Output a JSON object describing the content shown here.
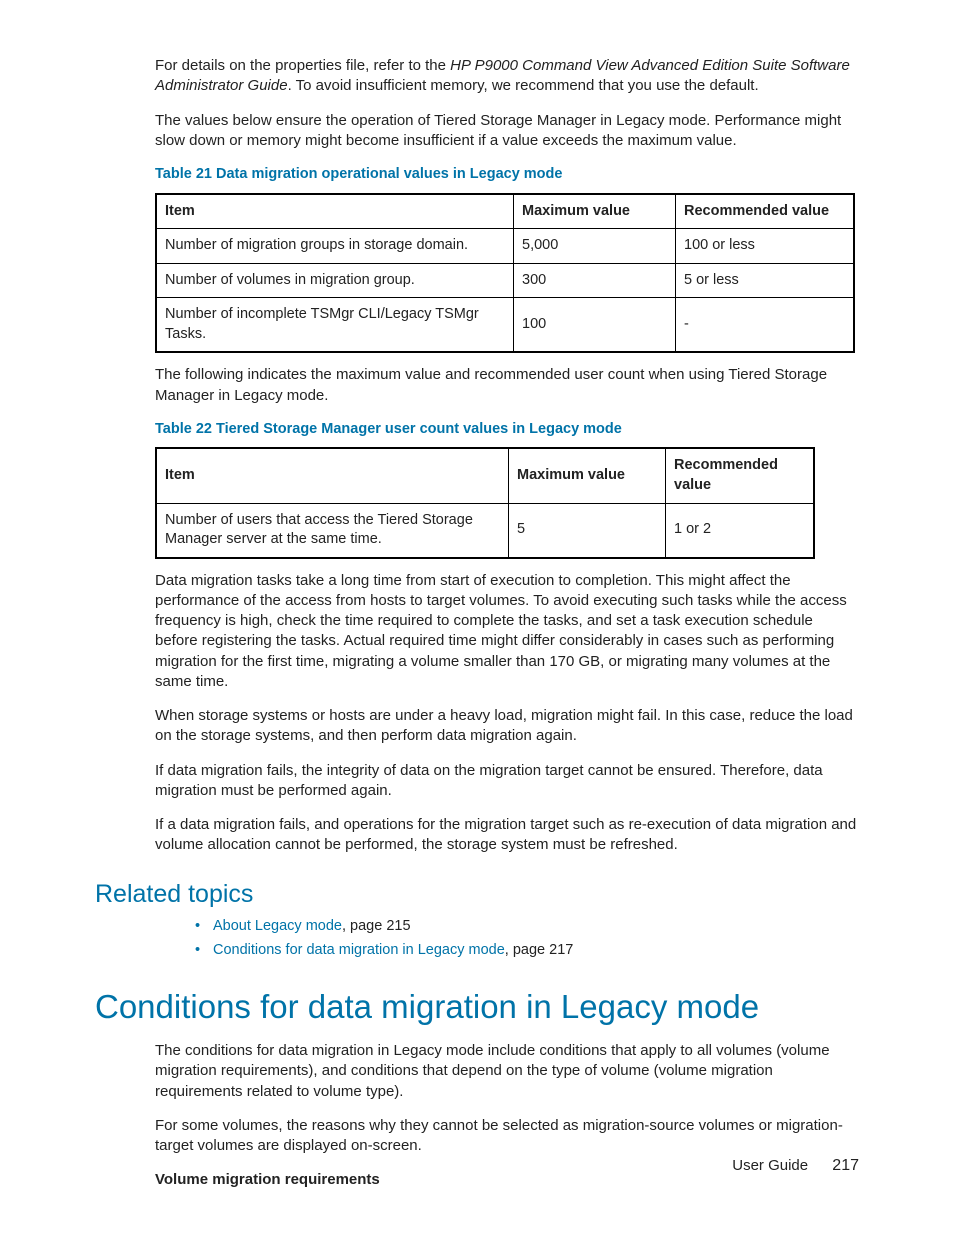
{
  "p1a": "For details on the properties file, refer to the ",
  "p1b": "HP P9000 Command View Advanced Edition Suite Software Administrator Guide",
  "p1c": ". To avoid insufficient memory, we recommend that you use the default.",
  "p2": "The values below ensure the operation of Tiered Storage Manager in Legacy mode. Performance might slow down or memory might become insufficient if a value exceeds the maximum value.",
  "t21_title": "Table 21 Data migration operational values in Legacy mode",
  "t21": {
    "h1": "Item",
    "h2": "Maximum value",
    "h3": "Recommended value",
    "r1c1": "Number of migration groups in storage domain.",
    "r1c2": "5,000",
    "r1c3": "100 or less",
    "r2c1": "Number of volumes in migration group.",
    "r2c2": "300",
    "r2c3": "5 or less",
    "r3c1": "Number of incomplete TSMgr CLI/Legacy TSMgr Tasks.",
    "r3c2": "100",
    "r3c3": "-"
  },
  "p3": "The following indicates the maximum value and recommended user count when using Tiered Storage Manager in Legacy mode.",
  "t22_title": "Table 22 Tiered Storage Manager user count values in Legacy mode",
  "t22": {
    "h1": "Item",
    "h2": "Maximum value",
    "h3": "Recommended value",
    "r1c1": "Number of users that access the Tiered Storage Manager server at the same time.",
    "r1c2": "5",
    "r1c3": "1 or 2"
  },
  "p4": "Data migration tasks take a long time from start of execution to completion. This might affect the performance of the access from hosts to target volumes. To avoid executing such tasks while the access frequency is high, check the time required to complete the tasks, and set a task execution schedule before registering the tasks. Actual required time might differ considerably in cases such as performing migration for the first time, migrating a volume smaller than 170 GB, or migrating many volumes at the same time.",
  "p5": "When storage systems or hosts are under a heavy load, migration might fail. In this case, reduce the load on the storage systems, and then perform data migration again.",
  "p6": "If data migration fails, the integrity of data on the migration target cannot be ensured. Therefore, data migration must be performed again.",
  "p7": "If a data migration fails, and operations for the migration target such as re-execution of data migration and volume allocation cannot be performed, the storage system must be refreshed.",
  "related_heading": "Related topics",
  "rel1_link": "About Legacy mode",
  "rel1_rest": ", page 215",
  "rel2_link": "Conditions for data migration in Legacy mode",
  "rel2_rest": ", page 217",
  "section_heading": "Conditions for data migration in Legacy mode",
  "p8": "The conditions for data migration in Legacy mode include conditions that apply to all volumes (volume migration requirements), and conditions that depend on the type of volume (volume migration requirements related to volume type).",
  "p9": "For some volumes, the reasons why they cannot be selected as migration-source volumes or migration-target volumes are displayed on-screen.",
  "subhead": "Volume migration requirements",
  "footer_label": "User Guide",
  "footer_page": "217"
}
